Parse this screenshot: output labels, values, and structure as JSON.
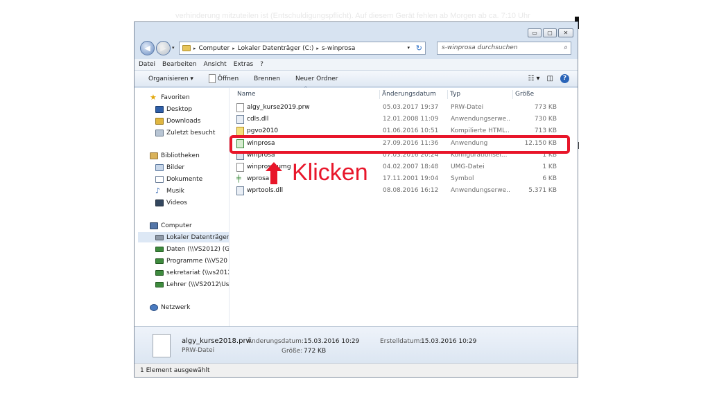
{
  "background_text": "verhinderung mitzuteilen ist (Entschuldigungspflicht). Auf diesem Gerät fehlen ab Morgen ab ca. 7:10 Uhr",
  "window": {
    "controls": {
      "minimize": "▭",
      "maximize": "▢",
      "close": "✕"
    }
  },
  "address_bar": {
    "crumbs": [
      "Computer",
      "Lokaler Datenträger (C:)",
      "s-winprosa"
    ],
    "separator": "▸"
  },
  "search": {
    "placeholder": "s-winprosa durchsuchen"
  },
  "menu": [
    "Datei",
    "Bearbeiten",
    "Ansicht",
    "Extras",
    "?"
  ],
  "toolbar": {
    "organize": "Organisieren ▾",
    "open": "Öffnen",
    "burn": "Brennen",
    "new_folder": "Neuer Ordner"
  },
  "nav": {
    "favorites": {
      "label": "Favoriten",
      "items": [
        "Desktop",
        "Downloads",
        "Zuletzt besucht"
      ]
    },
    "libraries": {
      "label": "Bibliotheken",
      "items": [
        "Bilder",
        "Dokumente",
        "Musik",
        "Videos"
      ]
    },
    "computer": {
      "label": "Computer",
      "items": [
        "Lokaler Datenträger",
        "Daten (\\\\VS2012) (G:",
        "Programme (\\\\VS20",
        "sekretariat (\\\\vs2012",
        "Lehrer (\\\\VS2012\\Us"
      ]
    },
    "network": {
      "label": "Netzwerk"
    }
  },
  "columns": {
    "name": "Name",
    "date": "Änderungsdatum",
    "type": "Typ",
    "size": "Größe"
  },
  "files": [
    {
      "name": "algy_kurse2019.prw",
      "date": "05.03.2017 19:37",
      "type": "PRW-Datei",
      "size": "773 KB",
      "icon": "doc-icon"
    },
    {
      "name": "cdls.dll",
      "date": "12.01.2008 11:09",
      "type": "Anwendungserwe...",
      "size": "730 KB",
      "icon": "dll-icon"
    },
    {
      "name": "pgvo2010",
      "date": "01.06.2016 10:51",
      "type": "Kompilierte HTML...",
      "size": "713 KB",
      "icon": "html-help-icon"
    },
    {
      "name": "winprosa",
      "date": "27.09.2016 11:36",
      "type": "Anwendung",
      "size": "12.150 KB",
      "icon": "app-icon"
    },
    {
      "name": "winprosa",
      "date": "07.03.2016 20:24",
      "type": "Konfigurationsei...",
      "size": "1 KB",
      "icon": "config-icon"
    },
    {
      "name": "winprosa.umg",
      "date": "04.02.2007 18:48",
      "type": "UMG-Datei",
      "size": "1 KB",
      "icon": "doc-icon"
    },
    {
      "name": "wprosa",
      "date": "17.11.2001 19:04",
      "type": "Symbol",
      "size": "6 KB",
      "icon": "symbol-icon"
    },
    {
      "name": "wprtools.dll",
      "date": "08.08.2016 16:12",
      "type": "Anwendungserwe...",
      "size": "5.371 KB",
      "icon": "dll-icon"
    }
  ],
  "details": {
    "filename": "algy_kurse2018.prw",
    "filetype": "PRW-Datei",
    "modified_label": "Änderungsdatum:",
    "modified_value": "15.03.2016 10:29",
    "created_label": "Erstelldatum:",
    "created_value": "15.03.2016 10:29",
    "size_label": "Größe:",
    "size_value": "772 KB"
  },
  "status": "1 Element ausgewählt",
  "annotation": {
    "text": "Klicken",
    "color": "#e8162a"
  }
}
